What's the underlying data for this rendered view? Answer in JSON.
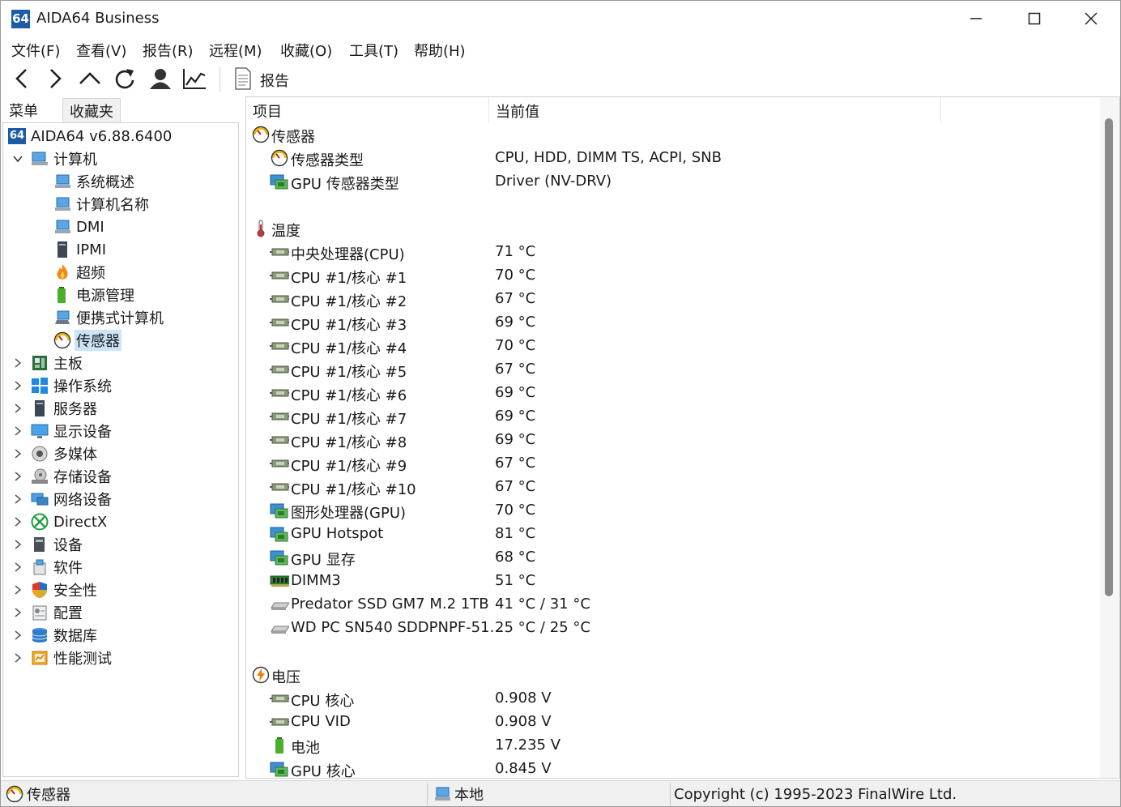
{
  "window": {
    "logo_text": "64",
    "title": "AIDA64 Business"
  },
  "menu": [
    "文件(F)",
    "查看(V)",
    "报告(R)",
    "远程(M)",
    "收藏(O)",
    "工具(T)",
    "帮助(H)"
  ],
  "toolbar": {
    "report_label": "报告"
  },
  "left_tabs": {
    "menu": "菜单",
    "favorites": "收藏夹"
  },
  "tree": {
    "root": "AIDA64 v6.88.6400",
    "computer": "计算机",
    "computer_children": [
      "系统概述",
      "计算机名称",
      "DMI",
      "IPMI",
      "超频",
      "电源管理",
      "便携式计算机",
      "传感器"
    ],
    "categories": [
      "主板",
      "操作系统",
      "服务器",
      "显示设备",
      "多媒体",
      "存储设备",
      "网络设备",
      "DirectX",
      "设备",
      "软件",
      "安全性",
      "配置",
      "数据库",
      "性能测试"
    ]
  },
  "list": {
    "col_item": "项目",
    "col_value": "当前值",
    "rows": [
      {
        "type": "group",
        "icon": "gauge-icon",
        "name": "传感器"
      },
      {
        "type": "item",
        "icon": "gauge-icon",
        "name": "传感器类型",
        "value": "CPU, HDD, DIMM TS, ACPI, SNB"
      },
      {
        "type": "item",
        "icon": "gpu-icon",
        "name": "GPU 传感器类型",
        "value": "Driver  (NV-DRV)"
      },
      {
        "type": "blank"
      },
      {
        "type": "group",
        "icon": "thermometer-icon",
        "name": "温度"
      },
      {
        "type": "item",
        "icon": "cpu-chip-icon",
        "name": "中央处理器(CPU)",
        "value": "71 °C"
      },
      {
        "type": "item",
        "icon": "cpu-chip-icon",
        "name": "CPU #1/核心 #1",
        "value": "70 °C"
      },
      {
        "type": "item",
        "icon": "cpu-chip-icon",
        "name": "CPU #1/核心 #2",
        "value": "67 °C"
      },
      {
        "type": "item",
        "icon": "cpu-chip-icon",
        "name": "CPU #1/核心 #3",
        "value": "69 °C"
      },
      {
        "type": "item",
        "icon": "cpu-chip-icon",
        "name": "CPU #1/核心 #4",
        "value": "70 °C"
      },
      {
        "type": "item",
        "icon": "cpu-chip-icon",
        "name": "CPU #1/核心 #5",
        "value": "67 °C"
      },
      {
        "type": "item",
        "icon": "cpu-chip-icon",
        "name": "CPU #1/核心 #6",
        "value": "69 °C"
      },
      {
        "type": "item",
        "icon": "cpu-chip-icon",
        "name": "CPU #1/核心 #7",
        "value": "69 °C"
      },
      {
        "type": "item",
        "icon": "cpu-chip-icon",
        "name": "CPU #1/核心 #8",
        "value": "69 °C"
      },
      {
        "type": "item",
        "icon": "cpu-chip-icon",
        "name": "CPU #1/核心 #9",
        "value": "67 °C"
      },
      {
        "type": "item",
        "icon": "cpu-chip-icon",
        "name": "CPU #1/核心 #10",
        "value": "67 °C"
      },
      {
        "type": "item",
        "icon": "gpu-icon",
        "name": "图形处理器(GPU)",
        "value": "70 °C"
      },
      {
        "type": "item",
        "icon": "gpu-icon",
        "name": "GPU Hotspot",
        "value": "81 °C"
      },
      {
        "type": "item",
        "icon": "gpu-icon",
        "name": "GPU 显存",
        "value": "68 °C"
      },
      {
        "type": "item",
        "icon": "ram-icon",
        "name": "DIMM3",
        "value": "51 °C"
      },
      {
        "type": "item",
        "icon": "ssd-icon",
        "name": "Predator SSD GM7 M.2 1TB",
        "value": "41 °C / 31 °C"
      },
      {
        "type": "item",
        "icon": "ssd-icon",
        "name": "WD PC SN540 SDDPNPF-51...",
        "value": "25 °C / 25 °C"
      },
      {
        "type": "blank"
      },
      {
        "type": "group",
        "icon": "voltage-icon",
        "name": "电压"
      },
      {
        "type": "item",
        "icon": "cpu-chip-icon",
        "name": "CPU 核心",
        "value": "0.908 V"
      },
      {
        "type": "item",
        "icon": "cpu-chip-icon",
        "name": "CPU VID",
        "value": "0.908 V"
      },
      {
        "type": "item",
        "icon": "battery-icon",
        "name": "电池",
        "value": "17.235 V"
      },
      {
        "type": "item",
        "icon": "gpu-icon",
        "name": "GPU 核心",
        "value": "0.845 V"
      }
    ]
  },
  "status": {
    "section": "传感器",
    "location": "本地",
    "copyright": "Copyright (c) 1995-2023 FinalWire Ltd."
  },
  "colors": {
    "logo_blue": "#1d5aa8",
    "selection": "#cce4f7",
    "statusbar": "#f0f0f0"
  }
}
